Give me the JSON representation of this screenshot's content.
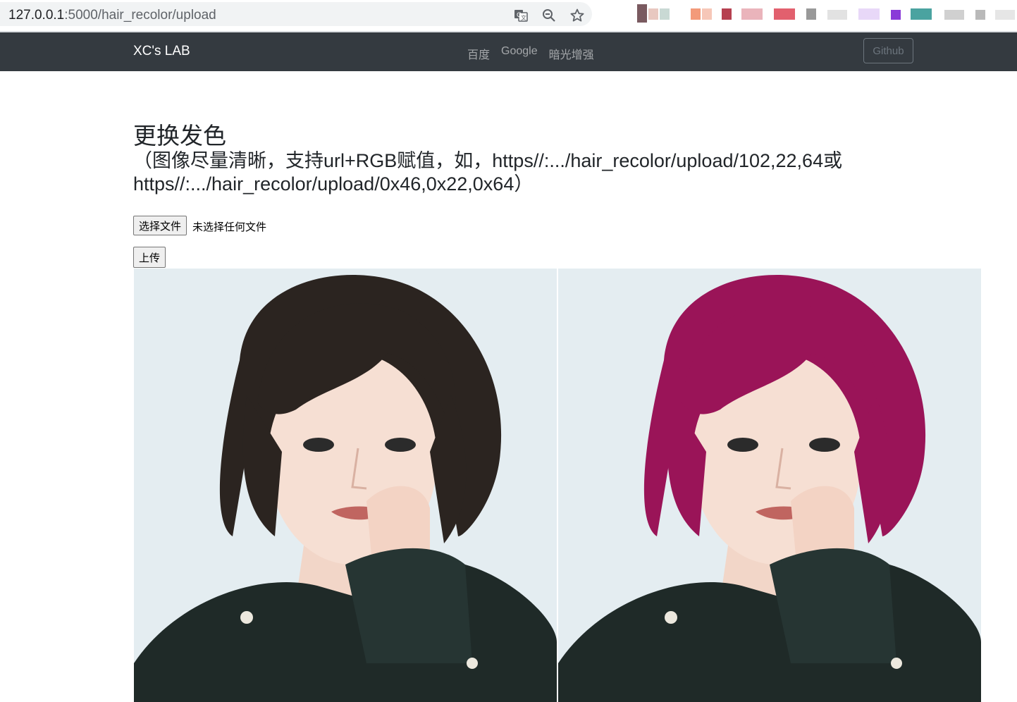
{
  "browser": {
    "url_host": "127.0.0.1",
    "url_rest": ":5000/hair_recolor/upload",
    "icons": [
      "translate-icon",
      "zoom-out-icon",
      "bookmark-star-icon"
    ]
  },
  "navbar": {
    "brand": "XC's LAB",
    "links": [
      "百度",
      "Google",
      "暗光增强"
    ],
    "github_label": "Github"
  },
  "content": {
    "title": "更换发色",
    "subtitle": "（图像尽量清晰，支持url+RGB赋值，如，https//:.../hair_recolor/upload/102,22,64或https//:.../hair_recolor/upload/0x46,0x22,0x64）",
    "file_button": "选择文件",
    "file_status": "未选择任何文件",
    "upload_button": "上传"
  },
  "images": {
    "original_hair_color": "#2b2420",
    "recolored_hair_color": "#9a1458"
  },
  "colors": {
    "navbar_bg": "#343a40",
    "photo_bg": "#e3edf2"
  }
}
